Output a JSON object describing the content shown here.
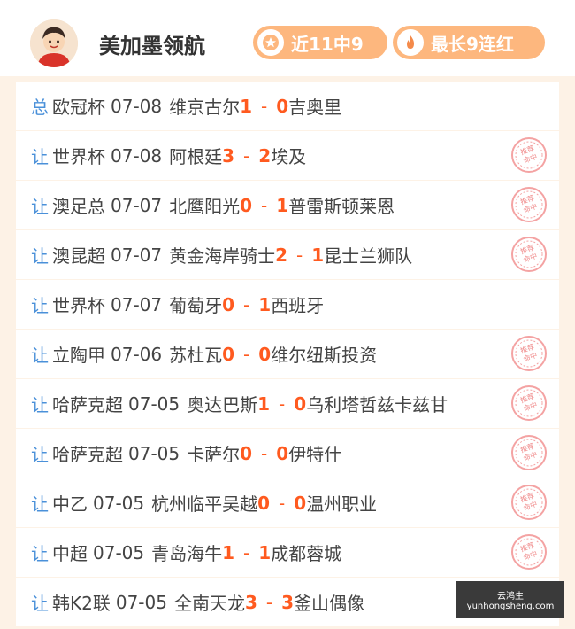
{
  "header": {
    "name": "美加墨领航",
    "badge_recent": "近11中9",
    "badge_streak": "最长9连红",
    "avatar_icon": "cartoon-avatar",
    "badge_recent_icon": "star-icon",
    "badge_streak_icon": "flame-icon"
  },
  "stamp_text": "推荐命中",
  "matches": [
    {
      "type": "总",
      "league": "欧冠杯",
      "date": "07-08",
      "home": "维京古尔",
      "hs": "1",
      "as": "0",
      "away": "吉奥里",
      "hit": false
    },
    {
      "type": "让",
      "league": "世界杯",
      "date": "07-08",
      "home": "阿根廷",
      "hs": "3",
      "as": "2",
      "away": "埃及",
      "hit": true
    },
    {
      "type": "让",
      "league": "澳足总",
      "date": "07-07",
      "home": "北鹰阳光",
      "hs": "0",
      "as": "1",
      "away": "普雷斯顿莱恩",
      "hit": true
    },
    {
      "type": "让",
      "league": "澳昆超",
      "date": "07-07",
      "home": "黄金海岸骑士",
      "hs": "2",
      "as": "1",
      "away": "昆士兰狮队",
      "hit": true
    },
    {
      "type": "让",
      "league": "世界杯",
      "date": "07-07",
      "home": "葡萄牙",
      "hs": "0",
      "as": "1",
      "away": "西班牙",
      "hit": false
    },
    {
      "type": "让",
      "league": "立陶甲",
      "date": "07-06",
      "home": "苏杜瓦",
      "hs": "0",
      "as": "0",
      "away": "维尔纽斯投资",
      "hit": true
    },
    {
      "type": "让",
      "league": "哈萨克超",
      "date": "07-05",
      "home": "奥达巴斯",
      "hs": "1",
      "as": "0",
      "away": "乌利塔哲兹卡兹甘",
      "hit": true
    },
    {
      "type": "让",
      "league": "哈萨克超",
      "date": "07-05",
      "home": "卡萨尔",
      "hs": "0",
      "as": "0",
      "away": "伊特什",
      "hit": true
    },
    {
      "type": "让",
      "league": "中乙",
      "date": "07-05",
      "home": "杭州临平吴越",
      "hs": "0",
      "as": "0",
      "away": "温州职业",
      "hit": true
    },
    {
      "type": "让",
      "league": "中超",
      "date": "07-05",
      "home": "青岛海牛",
      "hs": "1",
      "as": "1",
      "away": "成都蓉城",
      "hit": true
    },
    {
      "type": "让",
      "league": "韩K2联",
      "date": "07-05",
      "home": "全南天龙",
      "hs": "3",
      "as": "3",
      "away": "釜山偶像",
      "hit": true
    }
  ],
  "watermark": {
    "title": "云鸿生",
    "url": "yunhongsheng.com"
  }
}
